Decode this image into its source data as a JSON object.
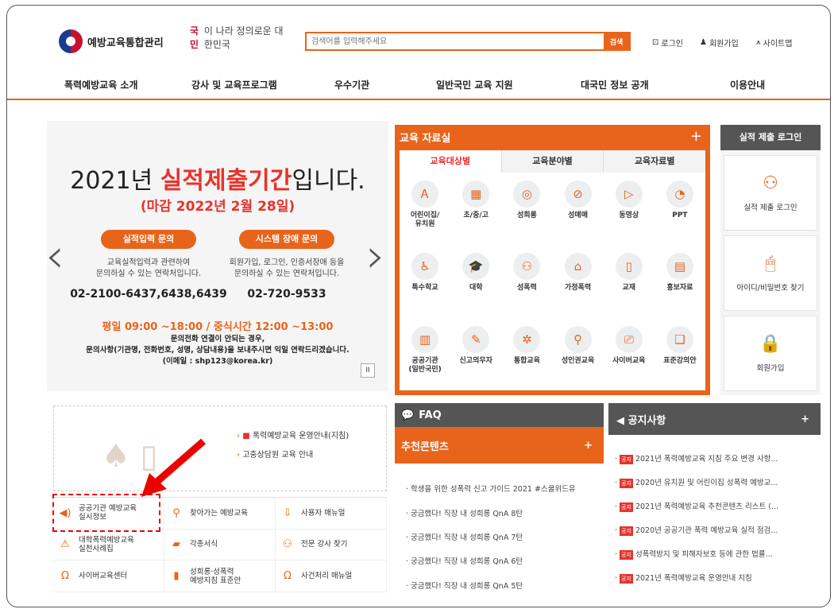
{
  "header": {
    "logo_text": "예방교육통합관리",
    "slogan_hl": "국민",
    "slogan_rest": "이 나라 정의로운 대한민국",
    "search_placeholder": "검색어를 입력해주세요",
    "search_button": "검색",
    "login": "로그인",
    "signup": "회원가입",
    "sitemap": "사이트맵"
  },
  "nav": [
    "폭력예방교육 소개",
    "강사 및 교육프로그램",
    "우수기관",
    "일반국민 교육 지원",
    "대국민 정보 공개",
    "이용안내"
  ],
  "hero": {
    "title_pre": "2021년 ",
    "title_em": "실적제출기간",
    "title_post": "입니다.",
    "deadline": "(마감 2022년 2월 28일)",
    "btn1": "실적입력 문의",
    "btn2": "시스템 장애 문의",
    "desc1_l1": "교육실적입력과 관련하여",
    "desc1_l2": "문의하실 수 있는 연락처입니다.",
    "desc2_l1": "회원가입, 로그인, 인증서장애 등을",
    "desc2_l2": "문의하실 수 있는 연락처입니다.",
    "phone1": "02-2100-6437,6438,6439",
    "phone2": "02-720-9533",
    "hours": "평일 09:00 ~18:00 / 중식시간 12:00 ~13:00",
    "note1": "문의전화 연결이 안되는 경우,",
    "note2": "문의사항(기관명, 전화번호, 성명, 상담내용)을 보내주시면 익일 연락드리겠습니다.",
    "note3": "(이메일 : shp123@korea.kr)",
    "pause": "II"
  },
  "edu": {
    "title": "교육 자료실",
    "plus": "+",
    "tabs": [
      "교육대상별",
      "교육분야별",
      "교육자료별"
    ],
    "items": [
      {
        "label": "어린이집/\n유치원",
        "icon": "Ꭺ"
      },
      {
        "label": "초/중/고",
        "icon": "▦"
      },
      {
        "label": "성희롱",
        "icon": "◎"
      },
      {
        "label": "성매매",
        "icon": "⊘"
      },
      {
        "label": "동영상",
        "icon": "▷"
      },
      {
        "label": "PPT",
        "icon": "◔"
      },
      {
        "label": "특수학교",
        "icon": "♿"
      },
      {
        "label": "대학",
        "icon": "🎓"
      },
      {
        "label": "성폭력",
        "icon": "⚇"
      },
      {
        "label": "가정폭력",
        "icon": "⌂"
      },
      {
        "label": "교재",
        "icon": "▯"
      },
      {
        "label": "홍보자료",
        "icon": "▤"
      },
      {
        "label": "공공기관\n(일반국민)",
        "icon": "▥"
      },
      {
        "label": "신고의무자",
        "icon": "✎"
      },
      {
        "label": "통합교육",
        "icon": "✲"
      },
      {
        "label": "성인권교육",
        "icon": "⚲"
      },
      {
        "label": "사이버교육",
        "icon": "⎚"
      },
      {
        "label": "표준강의안",
        "icon": "❏"
      }
    ]
  },
  "login_panel": {
    "title": "실적 제출 로그인",
    "boxes": [
      {
        "label": "실적 제출 로그인",
        "icon": "⚇"
      },
      {
        "label": "아이디/비밀번호 찾기",
        "icon": "🖱"
      },
      {
        "label": "회원가입",
        "icon": "🔒"
      }
    ]
  },
  "guide": {
    "link1": "폭력예방교육 운영안내(지침)",
    "link2": "고충상담원 교육 안내"
  },
  "quick": [
    {
      "label": "공공기관 예방교육\n실시정보",
      "icon": "◀)"
    },
    {
      "label": "찾아가는 예방교육",
      "icon": "⚲"
    },
    {
      "label": "사용자 매뉴얼",
      "icon": "⇩"
    },
    {
      "label": "대학폭력예방교육\n실천사례집",
      "icon": "⚠"
    },
    {
      "label": "각종서식",
      "icon": "▰"
    },
    {
      "label": "전문 강사 찾기",
      "icon": "⚇"
    },
    {
      "label": "사이버교육센터",
      "icon": "Ω"
    },
    {
      "label": "성희롱·성폭력\n예방지침 표준안",
      "icon": "▮"
    },
    {
      "label": "사건처리 매뉴얼",
      "icon": "Ω"
    }
  ],
  "faq": {
    "title": "FAQ"
  },
  "recommend": {
    "title": "추천콘텐츠",
    "plus": "+",
    "items": [
      "학생을 위한 성폭력 신고 가이드 2021 #스쿨위드유",
      "궁금했다! 직장 내 성희롱 QnA 8탄",
      "궁금했다! 직장 내 성희롱 QnA 7탄",
      "궁금했다! 직장 내 성희롱 QnA 6탄",
      "궁금했다! 직장 내 성희롱 QnA 5탄"
    ]
  },
  "notice": {
    "title": "공지사항",
    "plus": "+",
    "tag": "공지",
    "items": [
      "2021년 폭력예방교육 지침 주요 변경 사항...",
      "2020년 유치원 및 어린이집 성폭력 예방교...",
      "2021년 폭력예방교육 추천콘텐츠 리스트 (...",
      "2020년 공공기관 폭력 예방교육 실적 점검...",
      "성폭력방지 및 피해자보호 등에 관한 법률...",
      "2021년 폭력예방교육 운영안내 지침"
    ]
  }
}
